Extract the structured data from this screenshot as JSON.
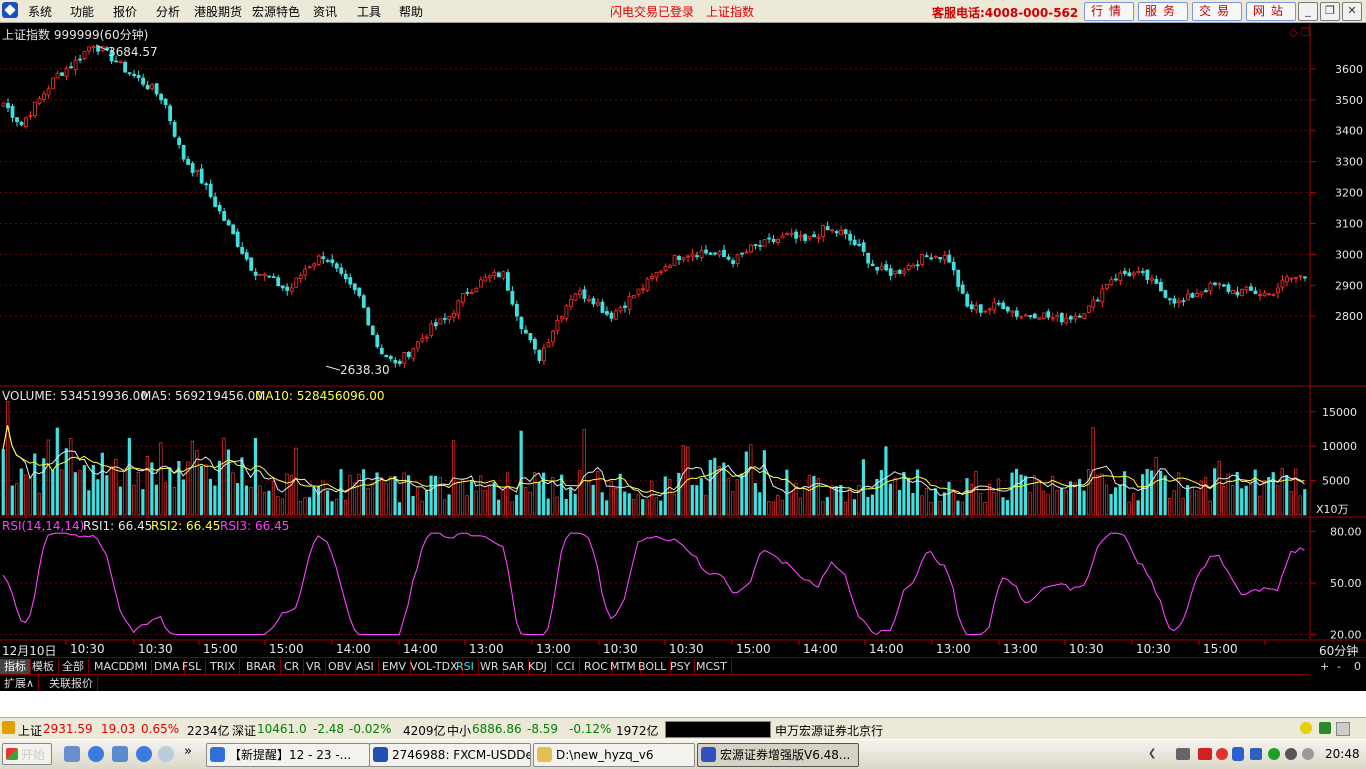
{
  "menu": {
    "items": [
      "系统",
      "功能",
      "报价",
      "分析",
      "港股期货",
      "宏源特色",
      "资讯",
      "工具",
      "帮助"
    ],
    "status1": "闪电交易已登录",
    "status2": "上证指数",
    "hotline": "客服电话:4008-000-562",
    "buttons": [
      "行情",
      "服务",
      "交易",
      "网站"
    ]
  },
  "chart": {
    "title": "上证指数 999999(60分钟)",
    "high_label": "3684.57",
    "low_label": "2638.30",
    "price_ticks": [
      "3600",
      "3500",
      "3400",
      "3300",
      "3200",
      "3100",
      "3000",
      "2900",
      "2800"
    ],
    "volume_label": "VOLUME: 534519936.00",
    "ma5_label": "MA5: 569219456.00",
    "ma10_label": "MA10: 528456096.00",
    "volume_ticks": [
      "15000",
      "10000",
      "5000"
    ],
    "volume_unit": "X10万",
    "rsi_label": "RSI(14,14,14)",
    "rsi1_label": "RSI1: 66.45",
    "rsi2_label": "RSI2: 66.45",
    "rsi3_label": "RSI3: 66.45",
    "rsi_ticks": [
      "80.00",
      "50.00",
      "20.00"
    ],
    "time_labels": [
      "12月10日",
      "10:30",
      "10:30",
      "15:00",
      "15:00",
      "14:00",
      "14:00",
      "13:00",
      "13:00",
      "10:30",
      "10:30",
      "15:00",
      "14:00",
      "14:00",
      "13:00",
      "13:00",
      "10:30",
      "10:30",
      "15:00"
    ],
    "period_label": "60分钟"
  },
  "chart_data": {
    "type": "candlestick",
    "title": "上证指数 999999(60分钟)",
    "price_range": [
      2600,
      3700
    ],
    "high": 3684.57,
    "low": 2638.3,
    "close_series": [
      3490,
      3420,
      3500,
      3580,
      3620,
      3684,
      3640,
      3590,
      3550,
      3500,
      3320,
      3250,
      3150,
      3050,
      2950,
      2920,
      2880,
      2960,
      3000,
      2920,
      2860,
      2700,
      2640,
      2700,
      2760,
      2800,
      2880,
      2920,
      2940,
      2780,
      2660,
      2780,
      2880,
      2860,
      2800,
      2850,
      2900,
      2960,
      3000,
      3010,
      3000,
      2980,
      3020,
      3040,
      3060,
      3040,
      3080,
      3070,
      3020,
      2950,
      2940,
      2970,
      3000,
      2990,
      2830,
      2820,
      2840,
      2800,
      2810,
      2790,
      2800,
      2830,
      2920,
      2940,
      2930,
      2880,
      2840,
      2880,
      2900,
      2880,
      2880,
      2870,
      2920,
      2930
    ],
    "volume_range": [
      0,
      17000
    ],
    "rsi_range": [
      18,
      82
    ],
    "rsi_last": 66.45,
    "volume_last": 534519936.0,
    "ma5_last": 569219456.0,
    "ma10_last": 528456096.0
  },
  "tabs": [
    "指标",
    "模板",
    "全部",
    "MACD",
    "DMI",
    "DMA",
    "FSL",
    "TRIX",
    "BRAR",
    "CR",
    "VR",
    "OBV",
    "ASI",
    "EMV",
    "VOL-TDX",
    "RSI",
    "WR",
    "SAR",
    "KDJ",
    "CCI",
    "ROC",
    "MTM",
    "BOLL",
    "PSY",
    "MCST"
  ],
  "tabs_right": [
    "+",
    "-",
    "0"
  ],
  "tabs2": [
    "扩展∧",
    "关联报价"
  ],
  "status": {
    "sh_name": "上证",
    "sh_val": "2931.59",
    "sh_chg": "19.03",
    "sh_pct": "0.65%",
    "sh_amt": "2234亿",
    "sz_name": "深证",
    "sz_val": "10461.0",
    "sz_chg": "-2.48",
    "sz_pct": "-0.02%",
    "sz_amt": "4209亿",
    "zx_name": "中小",
    "zx_val": "6886.86",
    "zx_chg": "-8.59",
    "zx_pct": "-0.12%",
    "zx_amt": "1972亿",
    "broker": "申万宏源证券北京行"
  },
  "taskbar": {
    "start": "开始",
    "windows": [
      "【新提醒】12 - 23 -...",
      "2746988: FXCM-USDDe...",
      "D:\\new_hyzq_v6",
      "宏源证券增强版V6.48..."
    ],
    "clock": "20:48"
  }
}
